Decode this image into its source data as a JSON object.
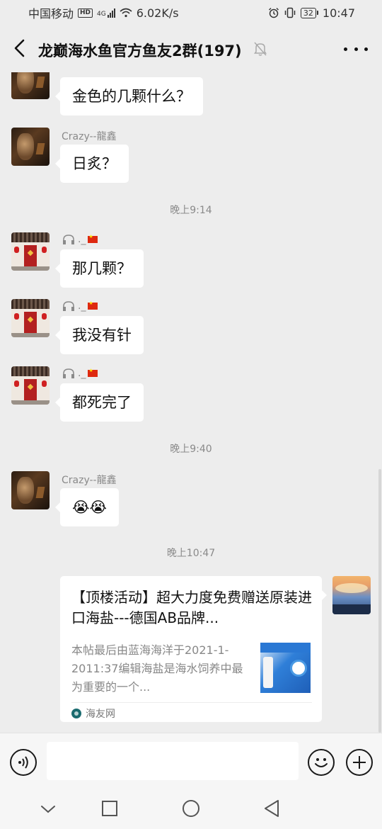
{
  "status_bar": {
    "carrier": "中国移动",
    "hd": "HD",
    "network": "4G",
    "speed": "6.02K/s",
    "battery": "32",
    "time": "10:47"
  },
  "header": {
    "title": "龙巅海水鱼官方鱼友2群(197)"
  },
  "messages": [
    {
      "sender": "Crazy--龍鑫",
      "text": "金色的几颗什么？",
      "avatar": "dark-portrait"
    },
    {
      "sender": "Crazy--龍鑫",
      "text": "日炙？",
      "avatar": "dark-portrait"
    },
    {
      "timestamp": "晚上9:14"
    },
    {
      "sender_suffix": "._",
      "text": "那几颗？",
      "avatar": "red-door"
    },
    {
      "sender_suffix": "._",
      "text": "我没有针",
      "avatar": "red-door"
    },
    {
      "sender_suffix": "._",
      "text": "都死完了",
      "avatar": "red-door"
    },
    {
      "timestamp": "晚上9:40"
    },
    {
      "sender": "Crazy--龍鑫",
      "text": "😭😭",
      "avatar": "dark-portrait"
    },
    {
      "timestamp": "晚上10:47"
    }
  ],
  "link_card": {
    "title": "【顶楼活动】超大力度免费赠送原装进口海盐---德国AB品牌...",
    "description": "本帖最后由蓝海海洋于2021-1-2011:37编辑海盐是海水饲养中最为重要的一个...",
    "source": "海友网"
  },
  "input_bar": {
    "placeholder": ""
  },
  "icons": {
    "back": "chevron-left-icon",
    "mute": "bell-off-icon",
    "more": "more-horizontal-icon",
    "voice": "voice-icon",
    "emoji": "emoji-icon",
    "plus": "plus-icon"
  }
}
